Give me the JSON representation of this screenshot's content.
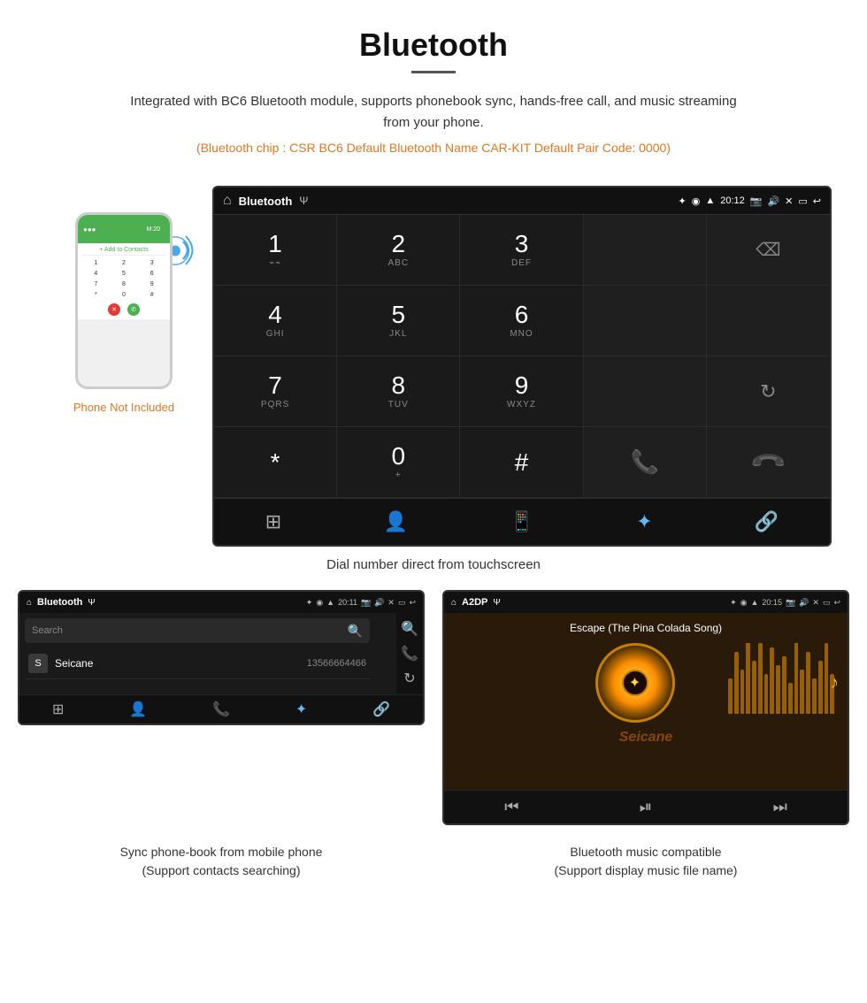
{
  "header": {
    "title": "Bluetooth",
    "description": "Integrated with BC6 Bluetooth module, supports phonebook sync, hands-free call, and music streaming from your phone.",
    "specs": "(Bluetooth chip : CSR BC6    Default Bluetooth Name CAR-KIT    Default Pair Code: 0000)"
  },
  "phone_label": "Phone Not Included",
  "dial_screen": {
    "title": "Bluetooth",
    "time": "20:12",
    "keys": [
      {
        "num": "1",
        "sub": ""
      },
      {
        "num": "2",
        "sub": "ABC"
      },
      {
        "num": "3",
        "sub": "DEF"
      },
      {
        "num": "",
        "sub": ""
      },
      {
        "num": "",
        "sub": "backspace"
      },
      {
        "num": "4",
        "sub": "GHI"
      },
      {
        "num": "5",
        "sub": "JKL"
      },
      {
        "num": "6",
        "sub": "MNO"
      },
      {
        "num": "",
        "sub": ""
      },
      {
        "num": "",
        "sub": ""
      },
      {
        "num": "7",
        "sub": "PQRS"
      },
      {
        "num": "8",
        "sub": "TUV"
      },
      {
        "num": "9",
        "sub": "WXYZ"
      },
      {
        "num": "",
        "sub": ""
      },
      {
        "num": "",
        "sub": "refresh"
      },
      {
        "num": "*",
        "sub": ""
      },
      {
        "num": "0",
        "sub": "+"
      },
      {
        "num": "#",
        "sub": ""
      },
      {
        "num": "",
        "sub": "call"
      },
      {
        "num": "",
        "sub": "endcall"
      }
    ]
  },
  "dial_caption": "Dial number direct from touchscreen",
  "phonebook_screen": {
    "title": "Bluetooth",
    "time": "20:11",
    "search_placeholder": "Search",
    "contact_name": "Seicane",
    "contact_letter": "S",
    "contact_number": "13566664466"
  },
  "music_screen": {
    "title": "A2DP",
    "time": "20:15",
    "song_title": "Escape (The Pina Colada Song)"
  },
  "bottom_captions": {
    "left": "Sync phone-book from mobile phone\n(Support contacts searching)",
    "right": "Bluetooth music compatible\n(Support display music file name)"
  },
  "seicane_watermark": "Seicane"
}
